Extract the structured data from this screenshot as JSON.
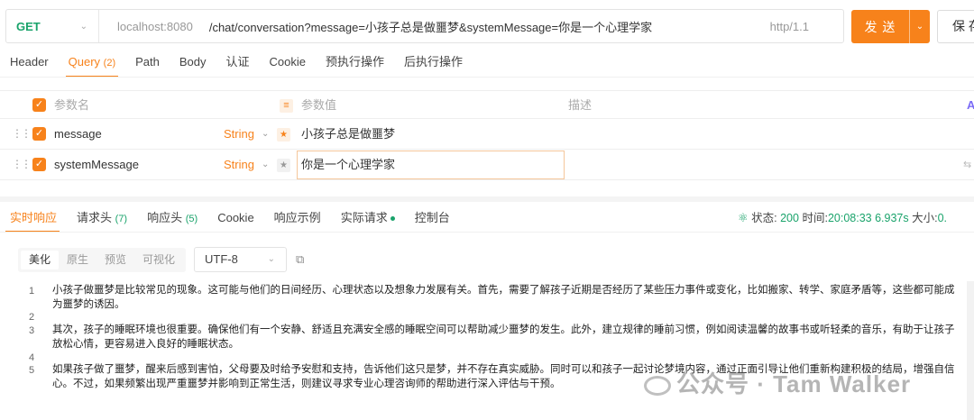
{
  "request": {
    "method": "GET",
    "host": "localhost:8080",
    "path": "/chat/conversation?message=小孩子总是做噩梦&systemMessage=你是一个心理学家",
    "protocol": "http/1.1",
    "send_label": "发 送",
    "save_label": "保 存"
  },
  "request_tabs": [
    {
      "label": "Header",
      "count": ""
    },
    {
      "label": "Query",
      "count": "(2)"
    },
    {
      "label": "Path",
      "count": ""
    },
    {
      "label": "Body",
      "count": ""
    },
    {
      "label": "认证",
      "count": ""
    },
    {
      "label": "Cookie",
      "count": ""
    },
    {
      "label": "预执行操作",
      "count": ""
    },
    {
      "label": "后执行操作",
      "count": ""
    }
  ],
  "params": {
    "header": {
      "name": "参数名",
      "value": "参数值",
      "description": "描述"
    },
    "rows": [
      {
        "name": "message",
        "type": "String",
        "value": "小孩子总是做噩梦"
      },
      {
        "name": "systemMessage",
        "type": "String",
        "value": "你是一个心理学家"
      }
    ]
  },
  "response_tabs": [
    {
      "label": "实时响应",
      "count": ""
    },
    {
      "label": "请求头",
      "count": "(7)"
    },
    {
      "label": "响应头",
      "count": "(5)"
    },
    {
      "label": "Cookie",
      "count": ""
    },
    {
      "label": "响应示例",
      "count": ""
    },
    {
      "label": "实际请求",
      "count": ""
    },
    {
      "label": "控制台",
      "count": ""
    }
  ],
  "status": {
    "status_label": "状态:",
    "status_code": "200",
    "time_label": "时间:",
    "time": "20:08:33",
    "duration": "6.937s",
    "size_label": "大小:",
    "size": "0."
  },
  "view_modes": [
    "美化",
    "原生",
    "预览",
    "可视化"
  ],
  "encoding": "UTF-8",
  "response_lines": [
    {
      "num": "1",
      "text": "小孩子做噩梦是比较常见的现象。这可能与他们的日间经历、心理状态以及想象力发展有关。首先，需要了解孩子近期是否经历了某些压力事件或变化，比如搬家、转学、家庭矛盾等，这些都可能成为噩梦的诱因。"
    },
    {
      "num": "2",
      "text": ""
    },
    {
      "num": "3",
      "text": "其次，孩子的睡眠环境也很重要。确保他们有一个安静、舒适且充满安全感的睡眠空间可以帮助减少噩梦的发生。此外，建立规律的睡前习惯，例如阅读温馨的故事书或听轻柔的音乐，有助于让孩子放松心情，更容易进入良好的睡眠状态。"
    },
    {
      "num": "4",
      "text": ""
    },
    {
      "num": "5",
      "text": "如果孩子做了噩梦，醒来后感到害怕，父母要及时给予安慰和支持，告诉他们这只是梦，并不存在真实威胁。同时可以和孩子一起讨论梦境内容，通过正面引导让他们重新构建积极的结局，增强自信心。不过，如果频繁出现严重噩梦并影响到正常生活，则建议寻求专业心理咨询师的帮助进行深入评估与干预。"
    }
  ],
  "watermark": "公众号 · Tam Walker"
}
